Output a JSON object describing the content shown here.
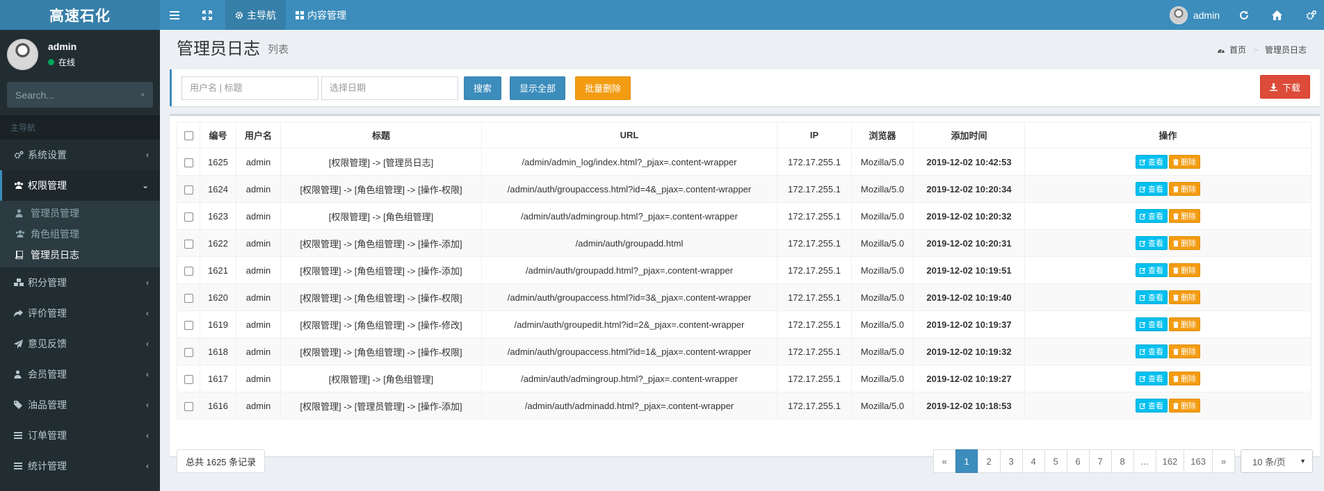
{
  "app": {
    "logo": "高速石化"
  },
  "topnav": {
    "main_nav": "主导航",
    "content_mgmt": "内容管理",
    "user": "admin"
  },
  "sidebar": {
    "user_name": "admin",
    "status": "在线",
    "search_placeholder": "Search...",
    "header": "主导航",
    "menu": {
      "system": "系统设置",
      "auth": "权限管理",
      "auth_sub": {
        "admin": "管理员管理",
        "group": "角色组管理",
        "log": "管理员日志"
      },
      "points": "积分管理",
      "review": "评价管理",
      "feedback": "意见反馈",
      "member": "会员管理",
      "fuel": "油品管理",
      "order": "订单管理",
      "stats": "统计管理"
    }
  },
  "page": {
    "title": "管理员日志",
    "subtitle": "列表",
    "breadcrumb_home": "首页",
    "breadcrumb_current": "管理员日志"
  },
  "toolbar": {
    "user_placeholder": "用户名 | 标题",
    "date_placeholder": "选择日期",
    "search": "搜索",
    "show_all": "显示全部",
    "batch_delete": "批量删除",
    "download": "下载"
  },
  "table": {
    "headers": {
      "id": "编号",
      "user": "用户名",
      "title": "标题",
      "url": "URL",
      "ip": "IP",
      "browser": "浏览器",
      "time": "添加时间",
      "ops": "操作"
    },
    "view_label": "查看",
    "delete_label": "删除",
    "rows": [
      {
        "id": "1625",
        "user": "admin",
        "title": "[权限管理] -> [管理员日志]",
        "url": "/admin/admin_log/index.html?_pjax=.content-wrapper",
        "ip": "172.17.255.1",
        "browser": "Mozilla/5.0",
        "time": "2019-12-02 10:42:53"
      },
      {
        "id": "1624",
        "user": "admin",
        "title": "[权限管理] -> [角色组管理] -> [操作-权限]",
        "url": "/admin/auth/groupaccess.html?id=4&_pjax=.content-wrapper",
        "ip": "172.17.255.1",
        "browser": "Mozilla/5.0",
        "time": "2019-12-02 10:20:34"
      },
      {
        "id": "1623",
        "user": "admin",
        "title": "[权限管理] -> [角色组管理]",
        "url": "/admin/auth/admingroup.html?_pjax=.content-wrapper",
        "ip": "172.17.255.1",
        "browser": "Mozilla/5.0",
        "time": "2019-12-02 10:20:32"
      },
      {
        "id": "1622",
        "user": "admin",
        "title": "[权限管理] -> [角色组管理] -> [操作-添加]",
        "url": "/admin/auth/groupadd.html",
        "ip": "172.17.255.1",
        "browser": "Mozilla/5.0",
        "time": "2019-12-02 10:20:31"
      },
      {
        "id": "1621",
        "user": "admin",
        "title": "[权限管理] -> [角色组管理] -> [操作-添加]",
        "url": "/admin/auth/groupadd.html?_pjax=.content-wrapper",
        "ip": "172.17.255.1",
        "browser": "Mozilla/5.0",
        "time": "2019-12-02 10:19:51"
      },
      {
        "id": "1620",
        "user": "admin",
        "title": "[权限管理] -> [角色组管理] -> [操作-权限]",
        "url": "/admin/auth/groupaccess.html?id=3&_pjax=.content-wrapper",
        "ip": "172.17.255.1",
        "browser": "Mozilla/5.0",
        "time": "2019-12-02 10:19:40"
      },
      {
        "id": "1619",
        "user": "admin",
        "title": "[权限管理] -> [角色组管理] -> [操作-修改]",
        "url": "/admin/auth/groupedit.html?id=2&_pjax=.content-wrapper",
        "ip": "172.17.255.1",
        "browser": "Mozilla/5.0",
        "time": "2019-12-02 10:19:37"
      },
      {
        "id": "1618",
        "user": "admin",
        "title": "[权限管理] -> [角色组管理] -> [操作-权限]",
        "url": "/admin/auth/groupaccess.html?id=1&_pjax=.content-wrapper",
        "ip": "172.17.255.1",
        "browser": "Mozilla/5.0",
        "time": "2019-12-02 10:19:32"
      },
      {
        "id": "1617",
        "user": "admin",
        "title": "[权限管理] -> [角色组管理]",
        "url": "/admin/auth/admingroup.html?_pjax=.content-wrapper",
        "ip": "172.17.255.1",
        "browser": "Mozilla/5.0",
        "time": "2019-12-02 10:19:27"
      },
      {
        "id": "1616",
        "user": "admin",
        "title": "[权限管理] -> [管理员管理] -> [操作-添加]",
        "url": "/admin/auth/adminadd.html?_pjax=.content-wrapper",
        "ip": "172.17.255.1",
        "browser": "Mozilla/5.0",
        "time": "2019-12-02 10:18:53"
      }
    ]
  },
  "footer": {
    "total": "总共 1625 条记录",
    "pages": [
      "«",
      "1",
      "2",
      "3",
      "4",
      "5",
      "6",
      "7",
      "8",
      "...",
      "162",
      "163",
      "»"
    ],
    "current_page": "1",
    "per_page": "10 条/页"
  },
  "colors": {
    "primary": "#3c8dbc",
    "sidebar": "#222d32",
    "warning": "#f39c12",
    "danger": "#dd4b39",
    "info": "#00c0ef"
  }
}
